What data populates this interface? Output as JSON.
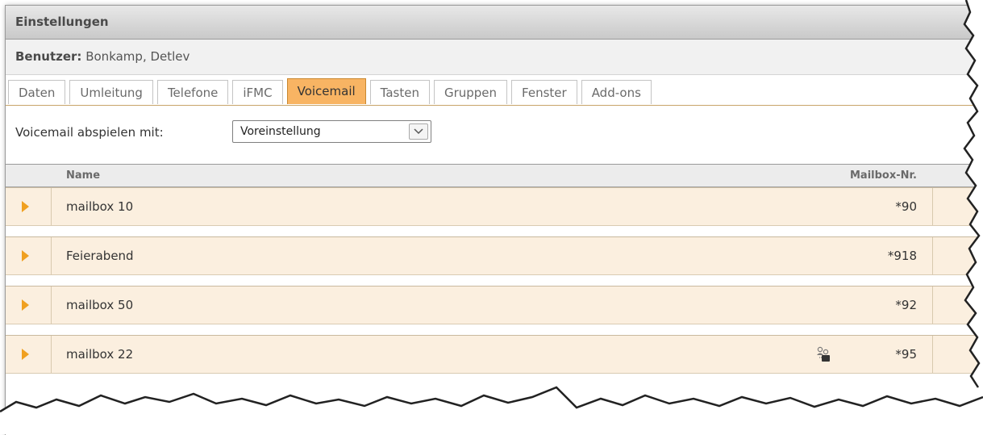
{
  "window": {
    "title": "Einstellungen"
  },
  "user": {
    "label": "Benutzer:",
    "value": "Bonkamp, Detlev"
  },
  "tabs": [
    {
      "label": "Daten",
      "active": false
    },
    {
      "label": "Umleitung",
      "active": false
    },
    {
      "label": "Telefone",
      "active": false
    },
    {
      "label": "iFMC",
      "active": false
    },
    {
      "label": "Voicemail",
      "active": true
    },
    {
      "label": "Tasten",
      "active": false
    },
    {
      "label": "Gruppen",
      "active": false
    },
    {
      "label": "Fenster",
      "active": false
    },
    {
      "label": "Add-ons",
      "active": false
    }
  ],
  "playback": {
    "label": "Voicemail abspielen mit:",
    "selected": "Voreinstellung"
  },
  "table": {
    "headers": {
      "name": "Name",
      "mailbox": "Mailbox-Nr."
    },
    "rows": [
      {
        "name": "mailbox 10",
        "mailbox": "*90",
        "icon": ""
      },
      {
        "name": "Feierabend",
        "mailbox": "*918",
        "icon": ""
      },
      {
        "name": "mailbox 50",
        "mailbox": "*92",
        "icon": ""
      },
      {
        "name": "mailbox 22",
        "mailbox": "*95",
        "icon": "user-group-icon"
      }
    ]
  },
  "colors": {
    "accent": "#f8b463",
    "row_bg": "#fbefdf",
    "arrow": "#f0a020"
  }
}
